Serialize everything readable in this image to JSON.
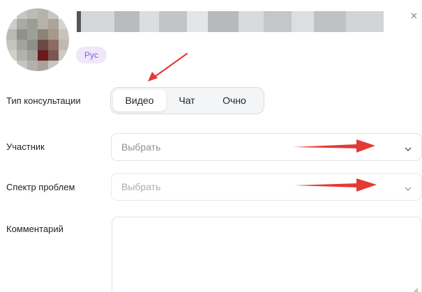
{
  "profile": {
    "language_badge": "Рус"
  },
  "form": {
    "consultation_type": {
      "label": "Тип консультации",
      "options": [
        "Видео",
        "Чат",
        "Очно"
      ],
      "selected": "Видео"
    },
    "participant": {
      "label": "Участник",
      "placeholder": "Выбрать"
    },
    "problem_spectrum": {
      "label": "Спектр проблем",
      "placeholder": "Выбрать"
    },
    "comment": {
      "label": "Комментарий"
    }
  },
  "icons": {
    "close": "close-icon",
    "chevron": "chevron-down-icon",
    "resize": "resize-handle-icon"
  },
  "colors": {
    "badge_bg": "#efe8fb",
    "badge_text": "#8a5ae0",
    "annotation_arrow": "#e53935"
  }
}
